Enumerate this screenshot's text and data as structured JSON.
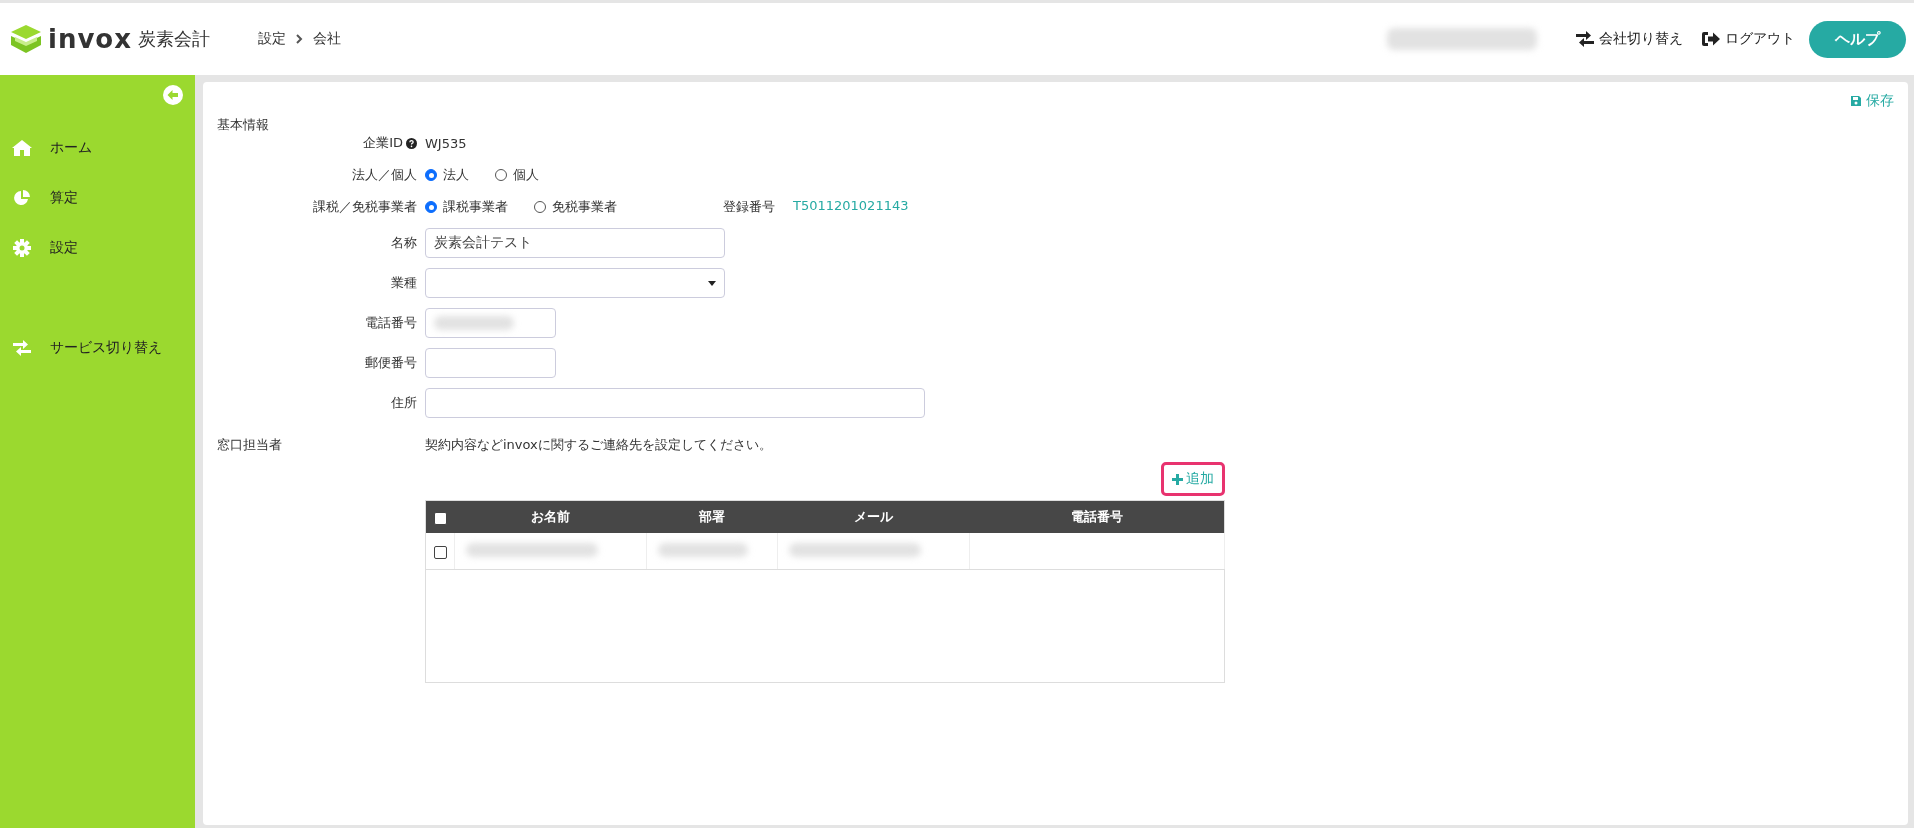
{
  "header": {
    "logo_word": "invox",
    "logo_suffix": "炭素会計",
    "breadcrumb": [
      "設定",
      "会社"
    ],
    "user_blurred": true,
    "actions": [
      {
        "kind": "switch",
        "label": "会社切り替え"
      },
      {
        "kind": "logout",
        "label": "ログアウト"
      }
    ],
    "help": "ヘルプ"
  },
  "sidebar": {
    "items": [
      {
        "kind": "home",
        "label": "ホーム"
      },
      {
        "kind": "chart",
        "label": "算定"
      },
      {
        "kind": "settings",
        "label": "設定"
      },
      {
        "kind": "switch",
        "label": "サービス切り替え"
      }
    ]
  },
  "save": "保存",
  "basic": {
    "title": "基本情報",
    "company_id": {
      "label": "企業ID",
      "value": "WJ535"
    },
    "entity": {
      "label": "法人／個人",
      "options": [
        {
          "label": "法人",
          "selected": true
        },
        {
          "label": "個人",
          "selected": false
        }
      ]
    },
    "tax": {
      "label": "課税／免税事業者",
      "options": [
        {
          "label": "課税事業者",
          "selected": true
        },
        {
          "label": "免税事業者",
          "selected": false
        }
      ],
      "registration_label": "登録番号",
      "registration_value": "T5011201021143"
    },
    "fields": [
      {
        "kind": "text",
        "label": "名称",
        "value": "炭素会計テスト"
      },
      {
        "kind": "select",
        "label": "業種"
      },
      {
        "kind": "short",
        "label": "電話番号",
        "blurred": true
      },
      {
        "kind": "short",
        "label": "郵便番号"
      },
      {
        "kind": "wide",
        "label": "住所"
      }
    ]
  },
  "contacts": {
    "title": "窓口担当者",
    "note": "契約内容などinvoxに関するご連絡先を設定してください。",
    "add": "追加",
    "add_highlighted": true,
    "select_all": false,
    "columns": [
      "お名前",
      "部署",
      "メール",
      "電話番号"
    ],
    "rows": [
      {
        "checked": false,
        "blurred": [
          true,
          true,
          true,
          false
        ]
      }
    ]
  }
}
